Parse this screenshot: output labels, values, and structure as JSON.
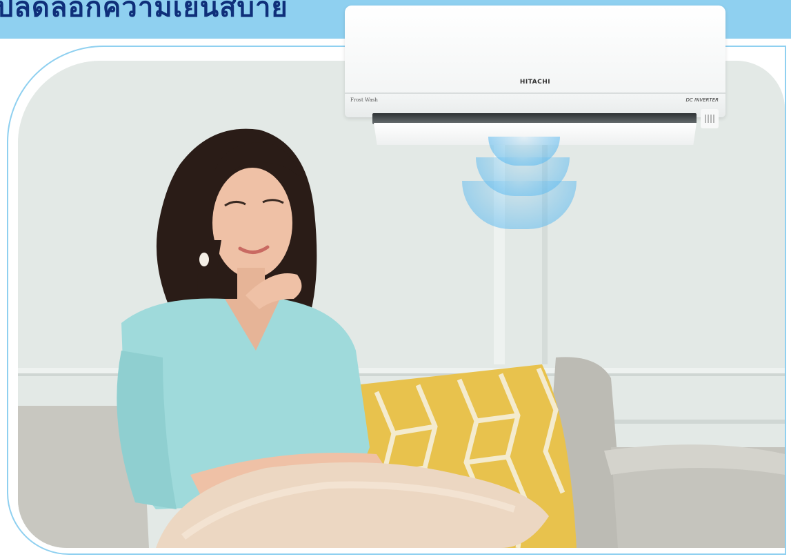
{
  "headline": {
    "text": "ปลดล็อกความเย็นสบาย"
  },
  "ac": {
    "brand": "HITACHI",
    "left_label": "Frost Wash",
    "right_label": "DC INVERTER"
  },
  "colors": {
    "banner": "#8fd0f0",
    "headline": "#0f2f7a",
    "cool_air": "#5ab9f0"
  }
}
